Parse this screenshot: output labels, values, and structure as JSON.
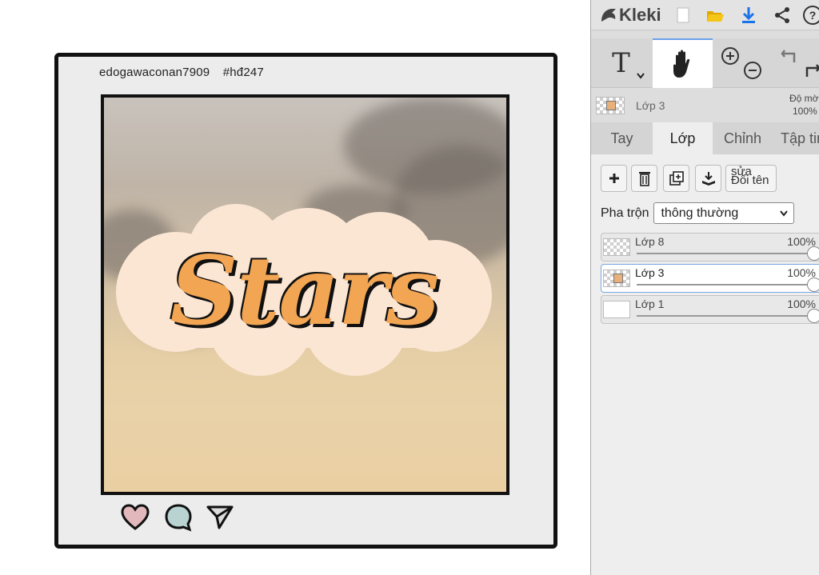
{
  "app": {
    "name": "Kleki"
  },
  "artwork": {
    "username": "edogawaconan7909",
    "hashtag": "#hđ247",
    "sticker_text": "Stars"
  },
  "toolbar": {
    "icons": [
      "new-file-icon",
      "open-folder-icon",
      "download-icon",
      "share-icon",
      "help-icon"
    ],
    "help_glyph": "?"
  },
  "tools": {
    "text_label": "T",
    "items": [
      "text-tool-icon",
      "hand-tool-icon",
      "zoom-in-icon",
      "zoom-out-icon",
      "undo-icon",
      "redo-icon"
    ]
  },
  "current_layer": {
    "name": "Lớp 3",
    "opacity_label": "Độ mờ",
    "opacity_value": "100%"
  },
  "tabs": [
    {
      "label": "Tay",
      "active": false
    },
    {
      "label": "Lớp",
      "active": true
    },
    {
      "label": "Chỉnh",
      "active": false
    },
    {
      "label": "Tập tin",
      "active": false
    }
  ],
  "layer_actions": {
    "rename_top": "sửa",
    "rename_bottom": "Đổi tên"
  },
  "blend": {
    "label": "Pha trộn",
    "value": "thông thường"
  },
  "layers": [
    {
      "name": "Lớp 8",
      "opacity": "100%",
      "selected": false,
      "opacity_fraction": 1.0
    },
    {
      "name": "Lớp 3",
      "opacity": "100%",
      "selected": true,
      "opacity_fraction": 1.0
    },
    {
      "name": "Lớp 1",
      "opacity": "100%",
      "selected": false,
      "opacity_fraction": 1.0
    }
  ],
  "colors": {
    "accent": "#6aa0e8",
    "sticker_orange": "#f2a553",
    "sticker_bg": "#fbe6d4",
    "download_blue": "#1a73e8",
    "folder_yellow": "#f5c518"
  }
}
